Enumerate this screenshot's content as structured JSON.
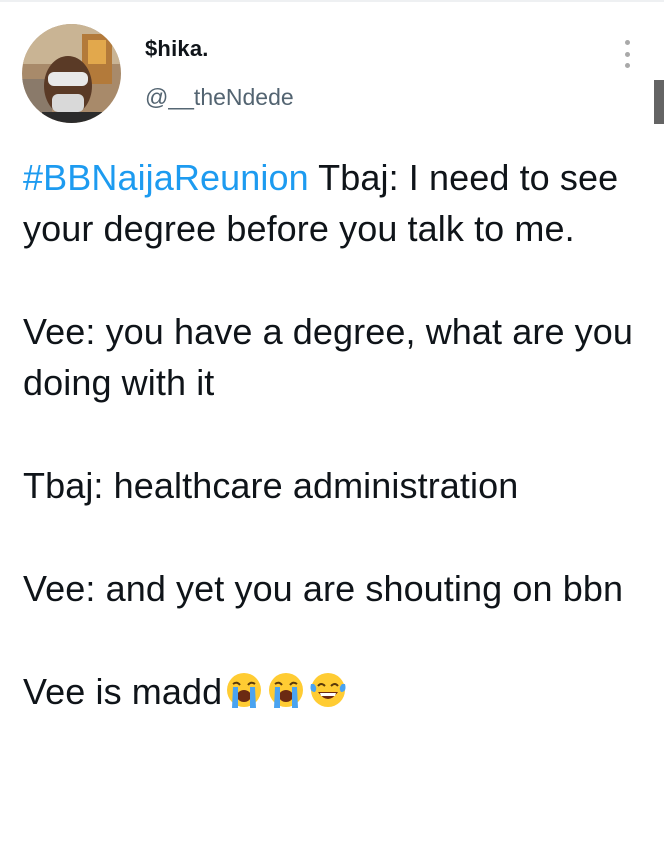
{
  "tweet": {
    "display_name": "$hika.",
    "handle": "@__theNdede",
    "hashtag": "#BBNaijaReunion",
    "paragraphs": {
      "p1_rest": " Tbaj: I need to see your degree before you talk to me.",
      "p2": "Vee: you have a degree, what are you doing with it",
      "p3": "Tbaj: healthcare administration",
      "p4": "Vee: and yet you are shouting on bbn",
      "p5_text": "Vee is madd"
    },
    "emojis": [
      "loudly-crying-face",
      "loudly-crying-face",
      "face-with-tears-of-joy"
    ]
  },
  "colors": {
    "hashtag": "#1d9bf0",
    "text": "#0f1419",
    "handle": "#536471"
  },
  "icons": {
    "more": "more-vertical-icon"
  }
}
